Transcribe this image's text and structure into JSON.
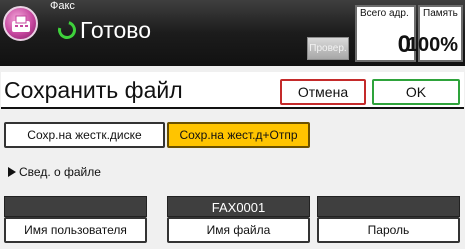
{
  "header": {
    "mode": "Факс",
    "status": "Готово",
    "check_label": "Провер.",
    "address_label": "Всего адр.",
    "address_count": "0",
    "memory_label": "Память",
    "memory_value": "100%"
  },
  "dialog": {
    "title": "Сохранить файл",
    "cancel_label": "Отмена",
    "ok_label": "OK"
  },
  "options": {
    "store_hdd": "Сохр.на жестк.диске",
    "store_send": "Сохр.на жест.д+Отпр"
  },
  "file_info": {
    "heading": "Свед. о файле",
    "user_name": {
      "value": "",
      "label": "Имя пользователя"
    },
    "file_name": {
      "value": "FAX0001",
      "label": "Имя файла"
    },
    "password": {
      "value": "",
      "label": "Пароль"
    }
  },
  "colors": {
    "selected": "#ffc400",
    "cancel_border": "#c42a2a",
    "ok_border": "#2ea33b",
    "status_ready": "#3ed13b"
  }
}
